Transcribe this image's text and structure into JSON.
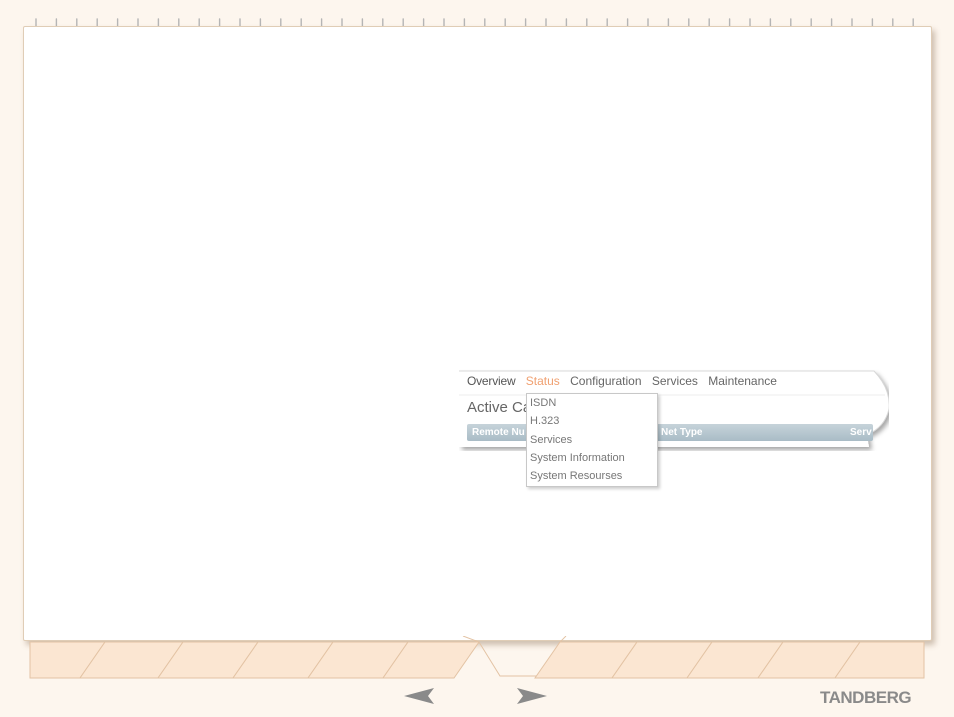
{
  "menu": {
    "items": [
      "Overview",
      "Status",
      "Configuration",
      "Services",
      "Maintenance"
    ],
    "active": "Status"
  },
  "heading": "Active Ca",
  "table_header": {
    "col1": "Remote Nu",
    "col2": "Net Type",
    "col3": "Serv"
  },
  "dropdown": {
    "items": [
      "ISDN",
      "H.323",
      "Services",
      "System Information",
      "System Resourses"
    ]
  },
  "brand": "TANDBERG",
  "colors": {
    "background": "#fdf6ee",
    "page_border": "#e0cdb6",
    "tab_fill": "#fbe6d2",
    "tab_stroke": "#e3c3a4",
    "active_menu": "#f0a070",
    "table_header": "#b4c6cf"
  },
  "icons": {
    "prev": "triangle-left-icon",
    "next": "triangle-right-icon"
  }
}
